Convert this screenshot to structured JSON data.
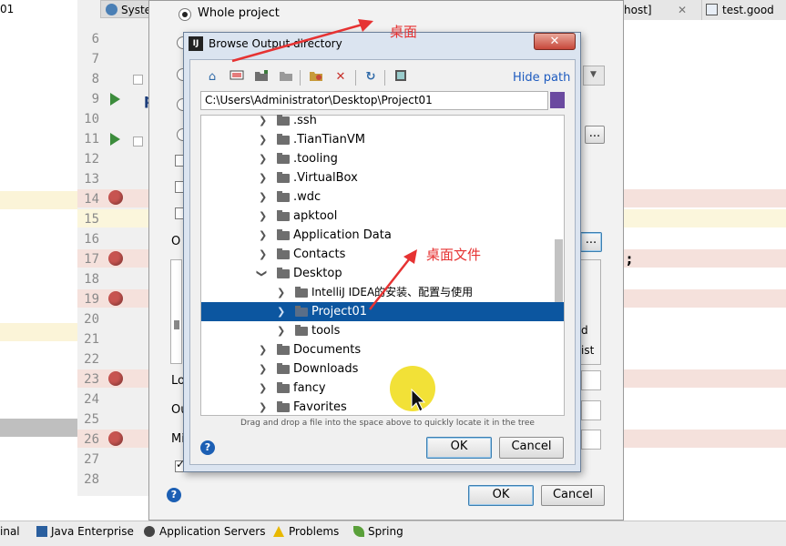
{
  "ide": {
    "left_package_text": "01",
    "line_numbers": [
      "6",
      "7",
      "8",
      "9",
      "10",
      "11",
      "12",
      "13",
      "14",
      "15",
      "16",
      "17",
      "18",
      "19",
      "20",
      "21",
      "22",
      "23",
      "24",
      "25",
      "26",
      "27",
      "28"
    ],
    "tabs": {
      "system": "Syste",
      "host": "host]",
      "test": "test.good"
    },
    "editor_fragment_p": "p",
    "editor_semicolon": ";"
  },
  "outer_dialog": {
    "whole_project_label": "Whole project",
    "left_labels": [
      "O",
      "Lo",
      "Ou",
      "Mi"
    ],
    "right_fragments": [
      "d",
      "ist"
    ],
    "ellipsis": "...",
    "ok_label": "OK",
    "cancel_label": "Cancel",
    "help": "?"
  },
  "browse_dialog": {
    "title": "Browse Output directory",
    "title_icon": "IJ",
    "close_label": "✕",
    "hide_path_label": "Hide path",
    "path_value": "C:\\Users\\Administrator\\Desktop\\Project01",
    "toolbar_icons": [
      "home-icon",
      "desktop-icon",
      "new-folder-icon",
      "folder-link-icon",
      "refresh-folder-icon",
      "delete-icon",
      "sync-icon",
      "show-hidden-icon"
    ],
    "tree": [
      {
        "label": ".ssh",
        "level": 0
      },
      {
        "label": ".TianTianVM",
        "level": 0
      },
      {
        "label": ".tooling",
        "level": 0
      },
      {
        "label": ".VirtualBox",
        "level": 0
      },
      {
        "label": ".wdc",
        "level": 0
      },
      {
        "label": "apktool",
        "level": 0
      },
      {
        "label": "Application Data",
        "level": 0
      },
      {
        "label": "Contacts",
        "level": 0
      },
      {
        "label": "Desktop",
        "level": 0,
        "expanded": true
      },
      {
        "label": "IntelliJ IDEA的安装、配置与使用",
        "level": 1
      },
      {
        "label": "Project01",
        "level": 1,
        "selected": true
      },
      {
        "label": "tools",
        "level": 1
      },
      {
        "label": "Documents",
        "level": 0
      },
      {
        "label": "Downloads",
        "level": 0
      },
      {
        "label": "fancy",
        "level": 0
      },
      {
        "label": "Favorites",
        "level": 0
      }
    ],
    "drag_hint": "Drag and drop a file into the space above to quickly locate it in the tree",
    "ok_label": "OK",
    "cancel_label": "Cancel",
    "help": "?"
  },
  "annotations": {
    "desktop_label": "桌面",
    "desktop_file_label": "桌面文件",
    "color": "#e63232"
  },
  "bottom_bar": {
    "items": [
      "inal",
      "Java Enterprise",
      "Application Servers",
      "Problems",
      "Spring"
    ]
  }
}
